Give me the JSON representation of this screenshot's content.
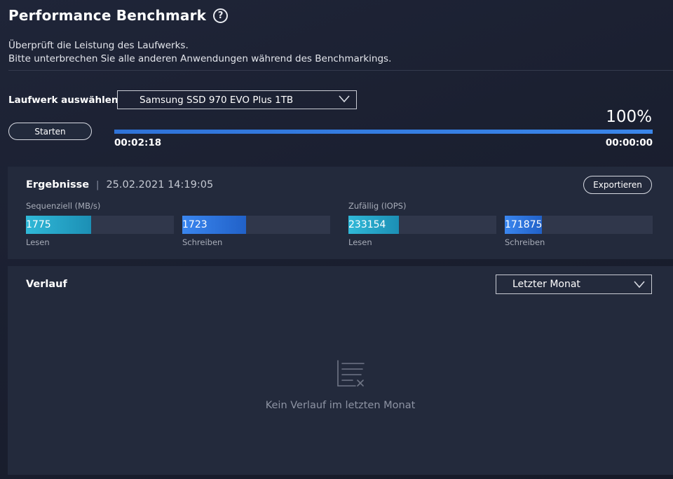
{
  "header": {
    "title": "Performance Benchmark",
    "help_icon": "question-circle-icon"
  },
  "description": {
    "line1": "Überprüft die Leistung des Laufwerks.",
    "line2": "Bitte unterbrechen Sie alle anderen Anwendungen während des Benchmarkings."
  },
  "drive": {
    "label": "Laufwerk auswählen",
    "selected": "Samsung SSD 970 EVO Plus 1TB"
  },
  "benchmark": {
    "start_label": "Starten",
    "progress_text": "100%",
    "progress": 1.0,
    "elapsed": "00:02:18",
    "remaining": "00:00:00"
  },
  "results": {
    "title": "Ergebnisse",
    "separator": "|",
    "date": "25.02.2021 14:19:05",
    "export_label": "Exportieren",
    "sequential": {
      "label": "Sequenziell (MB/s)",
      "read": {
        "value": "1775",
        "label": "Lesen",
        "fill": 0.44
      },
      "write": {
        "value": "1723",
        "label": "Schreiben",
        "fill": 0.43
      }
    },
    "random": {
      "label": "Zufällig (IOPS)",
      "read": {
        "value": "233154",
        "label": "Lesen",
        "fill": 0.34
      },
      "write": {
        "value": "171875",
        "label": "Schreiben",
        "fill": 0.25
      }
    }
  },
  "history": {
    "title": "Verlauf",
    "period": "Letzter Monat",
    "empty_icon": "empty-list-icon",
    "empty_text": "Kein Verlauf im letzten Monat"
  },
  "colors": {
    "background": "#1c2131",
    "panel": "#232a3c",
    "accent_blue": "#2f73d8",
    "accent_cyan": "#30b9d8"
  }
}
